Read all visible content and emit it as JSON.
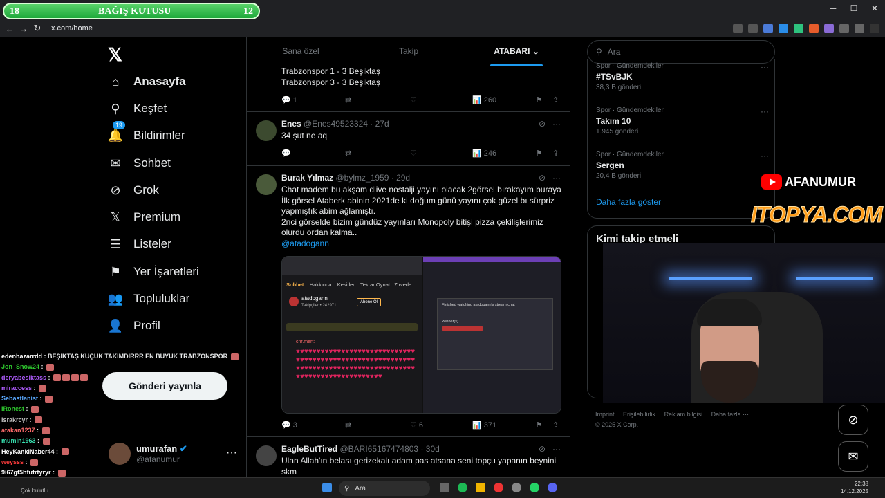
{
  "browser": {
    "url": "x.com/home",
    "donation": {
      "left_num": "18",
      "title": "BAĞIŞ KUTUSU",
      "right_num": "12"
    },
    "window_controls": [
      "─",
      "☐",
      "✕"
    ]
  },
  "sidebar": {
    "logo": "𝕏",
    "items": [
      {
        "label": "Anasayfa",
        "icon": "home-icon",
        "glyph": "⌂"
      },
      {
        "label": "Keşfet",
        "icon": "search-icon",
        "glyph": "⚲"
      },
      {
        "label": "Bildirimler",
        "icon": "bell-icon",
        "glyph": "🔔",
        "badge": "19"
      },
      {
        "label": "Sohbet",
        "icon": "mail-icon",
        "glyph": "✉"
      },
      {
        "label": "Grok",
        "icon": "grok-icon",
        "glyph": "⊘"
      },
      {
        "label": "Premium",
        "icon": "x-icon",
        "glyph": "𝕏"
      },
      {
        "label": "Listeler",
        "icon": "list-icon",
        "glyph": "☰"
      },
      {
        "label": "Yer İşaretleri",
        "icon": "bookmark-icon",
        "glyph": "⚑"
      },
      {
        "label": "Topluluklar",
        "icon": "community-icon",
        "glyph": "👥"
      },
      {
        "label": "Profil",
        "icon": "person-icon",
        "glyph": "👤"
      }
    ],
    "post_button": "Gönderi yayınla",
    "profile": {
      "name": "umurafan",
      "handle": "@afanumur"
    }
  },
  "chat": [
    {
      "user": "edenhazarrdd",
      "color": "#ffffff",
      "msg": ": BEŞİKTAŞ KÜÇÜK TAKIMDIRRR EN BÜYÜK TRABZONSPOR"
    },
    {
      "user": "Jon_Snow24",
      "color": "#2ec72e",
      "msg": ":"
    },
    {
      "user": "deryabesiktass",
      "color": "#b05cff",
      "msg": ":"
    },
    {
      "user": "miraccess",
      "color": "#b05cff",
      "msg": ":"
    },
    {
      "user": "Sebastlanist",
      "color": "#5aa9ff",
      "msg": ":"
    },
    {
      "user": "IRonest",
      "color": "#2ec72e",
      "msg": ":"
    },
    {
      "user": "Israkrcyr",
      "color": "#bbbbbb",
      "msg": ":"
    },
    {
      "user": "atakan1237",
      "color": "#ff6b6b",
      "msg": ":"
    },
    {
      "user": "mumin1963",
      "color": "#38e0b0",
      "msg": ":"
    },
    {
      "user": "HeyKankiNaber44",
      "color": "#ffffff",
      "msg": ":"
    },
    {
      "user": "weysss",
      "color": "#ff3c3c",
      "msg": ":"
    },
    {
      "user": "9i67gt5hfutrtyryr",
      "color": "#ffffff",
      "msg": ":"
    }
  ],
  "feed": {
    "tabs": [
      "Sana özel",
      "Takip",
      "ATABARI"
    ],
    "tweets": [
      {
        "lines": [
          "Trabzonspor 1 - 3 Beşiktaş",
          "Trabzonspor 3 - 3 Beşiktaş"
        ],
        "replies": "1",
        "views": "260"
      },
      {
        "name": "Enes",
        "handle": "@Enes49523324",
        "time": "27d",
        "text": "34 şut ne aq",
        "views": "246"
      },
      {
        "name": "Burak Yılmaz",
        "handle": "@bylmz_1959",
        "time": "29d",
        "text": "Chat madem bu akşam dlive nostalji yayını olacak 2görsel bırakayım buraya İlk görsel Ataberk abinin 2021de ki doğum günü yayını çok güzel bı sürpriz yapmıştık abim ağlamıştı.\n2nci görselde bizim gündüz yayınları Monopoly bitişi pizza çekilişlerimiz olurdu ordan kalma..",
        "mention": "@atadogann",
        "replies": "3",
        "likes": "6",
        "views": "371",
        "media_tabs": [
          "Sohbet",
          "Hakkında",
          "Kesitler",
          "Tekrar Oynat",
          "Zirvede"
        ],
        "media_user": "atadogann",
        "media_followers": "Takipçiler • 242971",
        "media_follow": "Abone Ol",
        "media_chat_user": "cnr.mert:",
        "media_right_title": "Finished watching atadogann's stream chat",
        "media_right_winner": "Winner(s)"
      },
      {
        "name": "EagleButTired",
        "handle": "@BARI65167474803",
        "time": "30d",
        "text": "Ulan Allah'ın belası gerizekalı adam pas atsana seni topçu yapanın beynini skm"
      }
    ]
  },
  "right": {
    "search_placeholder": "Ara",
    "trends": [
      {
        "cat": "Spor · Gündemdekiler",
        "title": "#TSvBJK",
        "count": "38,3 B gönderi"
      },
      {
        "cat": "Spor · Gündemdekiler",
        "title": "Takım 10",
        "count": "1.945 gönderi"
      },
      {
        "cat": "Spor · Gündemdekiler",
        "title": "Sergen",
        "count": "20,4 B gönderi"
      }
    ],
    "show_more": "Daha fazla göster",
    "who_to_follow": "Kimi takip etmeli",
    "footer_links": [
      "Imprint",
      "Erişilebilirlik",
      "Reklam bilgisi",
      "Daha fazla ···"
    ],
    "copyright": "© 2025 X Corp."
  },
  "overlay": {
    "channel": "AFANUMUR",
    "sponsor": "ITOPYA.COM"
  },
  "taskbar": {
    "search": "Ara",
    "weather": "Çok bulutlu",
    "time": "22:38",
    "date": "14.12.2025"
  }
}
